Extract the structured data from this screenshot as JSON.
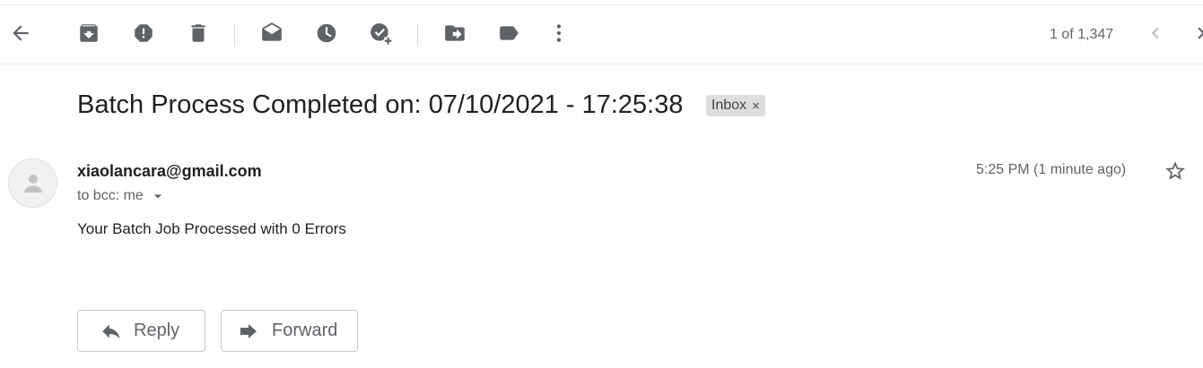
{
  "toolbar": {
    "icons": [
      "back-arrow-icon",
      "archive-icon",
      "report-spam-icon",
      "delete-icon",
      "mark-unread-icon",
      "snooze-icon",
      "add-task-icon",
      "move-to-icon",
      "label-icon",
      "more-vert-icon"
    ],
    "pager_text": "1 of 1,347"
  },
  "message": {
    "subject": "Batch Process Completed on: 07/10/2021 - 17:25:38",
    "label": "Inbox",
    "label_close": "×",
    "sender": "xiaolancara@gmail.com",
    "recipients": "to bcc: me",
    "time": "5:25 PM (1 minute ago)",
    "body": "Your Batch Job Processed with 0 Errors"
  },
  "actions": {
    "reply": "Reply",
    "forward": "Forward"
  },
  "colors": {
    "icon": "#5f6368",
    "chip_bg": "#dddddd"
  }
}
